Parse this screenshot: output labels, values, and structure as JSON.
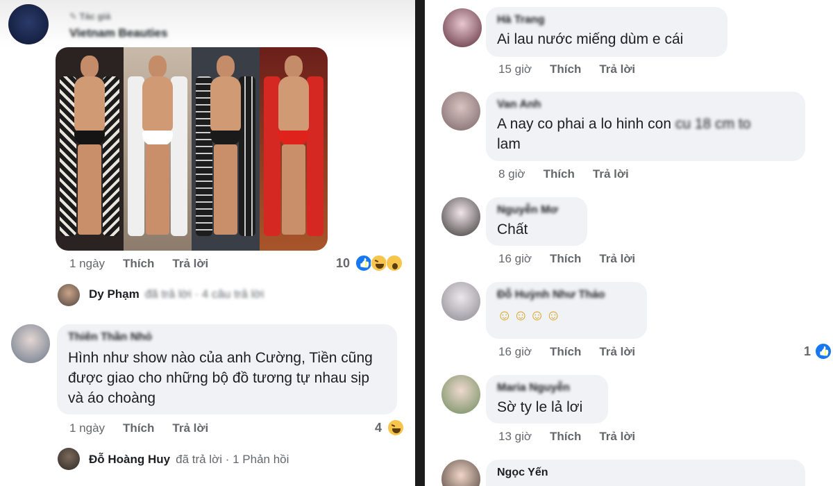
{
  "left": {
    "post": {
      "author_tag": "Tác giả",
      "author": "Vietnam Beauties",
      "pen_icon": "pencil-icon",
      "time": "1 ngày",
      "like_label": "Thích",
      "reply_label": "Trả lời",
      "reaction_count": "10",
      "reactions": [
        "like-icon",
        "haha-icon",
        "wow-icon"
      ]
    },
    "reply_summary_1": {
      "name": "Dy Phạm",
      "text": "đã trả lời · 4 câu trả lời"
    },
    "comment_1": {
      "author": "Thiên Thần Nhỏ",
      "text": "Hình như show nào của anh Cường, Tiền cũng được giao cho những bộ đồ tương tự nhau sịp và áo choàng",
      "time": "1 ngày",
      "like_label": "Thích",
      "reply_label": "Trả lời",
      "reaction_count": "4",
      "reactions": [
        "haha-icon"
      ]
    },
    "reply_summary_2": {
      "name": "Đỗ Hoàng Huy",
      "text": "đã trả lời · 1 Phản hồi"
    }
  },
  "right": {
    "comments": [
      {
        "author": "Hà Trang",
        "text": "Ai lau nước miếng dùm e cái",
        "time": "15 giờ",
        "like_label": "Thích",
        "reply_label": "Trả lời"
      },
      {
        "author": "Van Anh",
        "text_a": "A nay co phai a lo hinh con",
        "text_blur": "cu 18 cm to",
        "text_b": "lam",
        "time": "8 giờ",
        "like_label": "Thích",
        "reply_label": "Trả lời"
      },
      {
        "author": "Nguyễn Mơ",
        "text": "Chất",
        "time": "16 giờ",
        "like_label": "Thích",
        "reply_label": "Trả lời"
      },
      {
        "author": "Đỗ Huỳnh Như Thảo",
        "text": "☺☺☺☺",
        "time": "16 giờ",
        "like_label": "Thích",
        "reply_label": "Trả lời",
        "reaction_count": "1"
      },
      {
        "author": "Maria Nguyễn",
        "text": "Sờ ty le lả lơi",
        "time": "13 giờ",
        "like_label": "Thích",
        "reply_label": "Trả lời"
      },
      {
        "author": "Ngọc Yến"
      }
    ]
  },
  "colors": {
    "bubble": "#f0f2f5",
    "meta": "#65676b",
    "like_blue": "#1877f2",
    "divider": "#1c1c1c"
  }
}
